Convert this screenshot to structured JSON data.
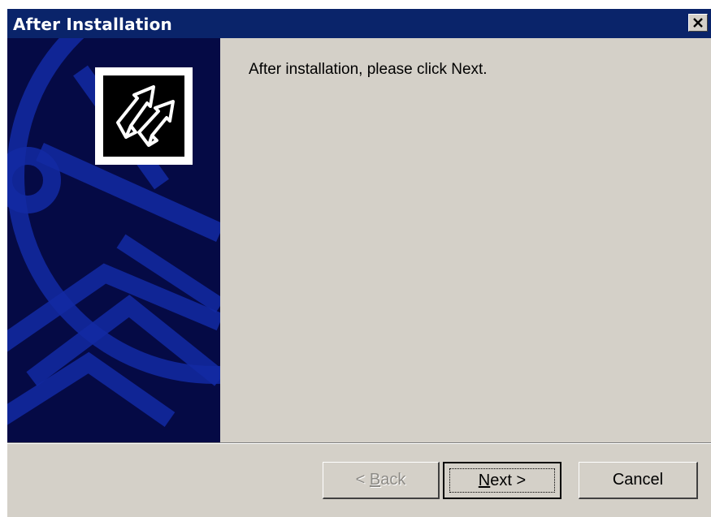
{
  "window": {
    "title": "After Installation"
  },
  "icons": {
    "close": "close-icon",
    "logo": "install-arrows-logo-icon"
  },
  "content": {
    "message": "After installation, please click Next."
  },
  "buttons": {
    "back": {
      "accel": "B",
      "rest": "ack",
      "prefix": "< ",
      "state": "disabled"
    },
    "next": {
      "accel": "N",
      "rest": "ext",
      "suffix": " >",
      "state": "default"
    },
    "cancel": "Cancel"
  },
  "colors": {
    "titlebar": "#0a246a",
    "panel_bg": "#050a45",
    "panel_lines": "#132aa3",
    "face": "#d4d0c8"
  }
}
